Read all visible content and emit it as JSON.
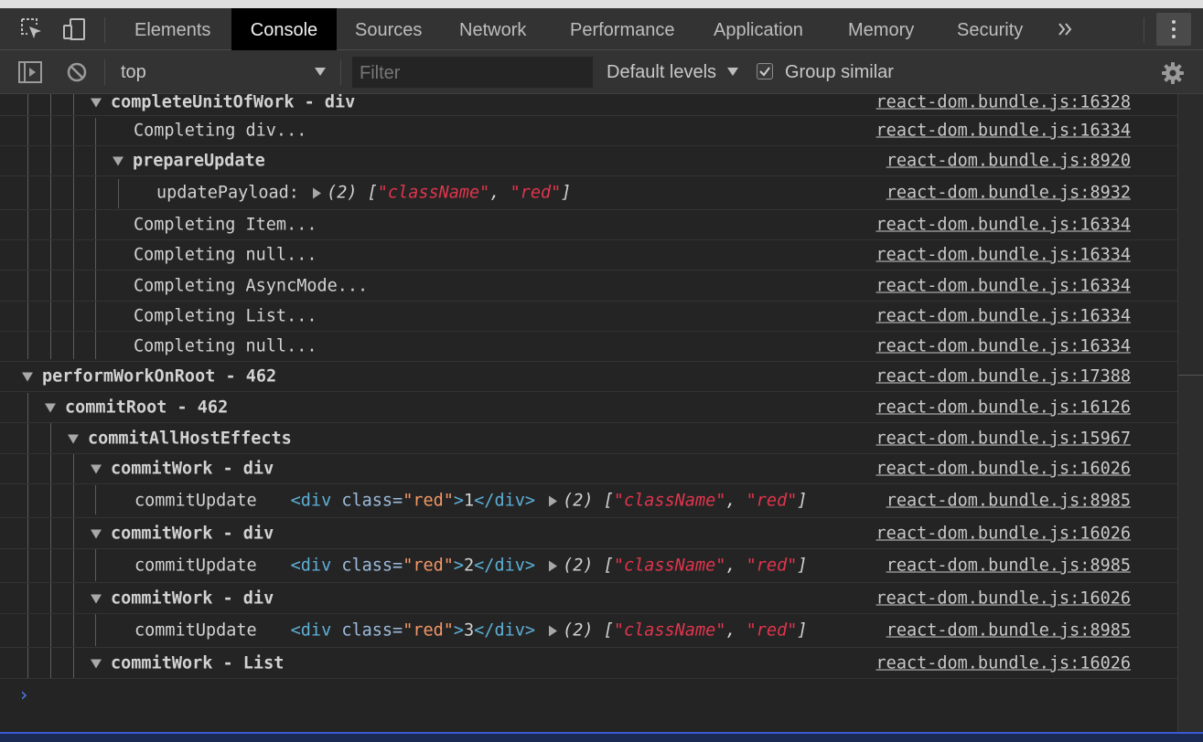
{
  "tabs": [
    "Elements",
    "Console",
    "Sources",
    "Network",
    "Performance",
    "Application",
    "Memory",
    "Security"
  ],
  "toolbar": {
    "context": "top",
    "filter_placeholder": "Filter",
    "levels": "Default levels",
    "group_similar": "Group similar",
    "group_similar_checked": true
  },
  "icons": [
    "inspect-icon",
    "device-toolbar-icon",
    "more-tabs-icon",
    "kebab-menu-icon",
    "sidebar-toggle-icon",
    "clear-console-icon",
    "settings-gear-icon"
  ],
  "colors": {
    "string": "#e0354d",
    "tag": "#5db0d7",
    "attr_value": "#f29766",
    "prompt": "#4d7ff0",
    "active_tab": "#000000"
  },
  "console": {
    "rows": [
      {
        "text": "completeUnitOfWork - div",
        "source": "react-dom.bundle.js:16328"
      },
      {
        "text": "Completing div...",
        "source": "react-dom.bundle.js:16334"
      },
      {
        "text": "prepareUpdate",
        "source": "react-dom.bundle.js:8920"
      },
      {
        "label": "updatePayload:",
        "arr_count": "(2)",
        "arr_open": "[",
        "s1": "\"className\"",
        "comma": ", ",
        "s2": "\"red\"",
        "arr_close": "]",
        "source": "react-dom.bundle.js:8932"
      },
      {
        "text": "Completing Item...",
        "source": "react-dom.bundle.js:16334"
      },
      {
        "text": "Completing null...",
        "source": "react-dom.bundle.js:16334"
      },
      {
        "text": "Completing AsyncMode...",
        "source": "react-dom.bundle.js:16334"
      },
      {
        "text": "Completing List...",
        "source": "react-dom.bundle.js:16334"
      },
      {
        "text": "Completing null...",
        "source": "react-dom.bundle.js:16334"
      },
      {
        "text": "performWorkOnRoot - 462",
        "source": "react-dom.bundle.js:17388"
      },
      {
        "text": "commitRoot - 462",
        "source": "react-dom.bundle.js:16126"
      },
      {
        "text": "commitAllHostEffects",
        "source": "react-dom.bundle.js:15967"
      },
      {
        "text": "commitWork - div",
        "source": "react-dom.bundle.js:16026"
      },
      {
        "label": "commitUpdate",
        "tag_open": "<div",
        "attr": " class=",
        "aval": "\"red\"",
        "gt": ">",
        "content": "1",
        "tag_close": "</div>",
        "arr_count": "(2)",
        "arr_open": "[",
        "s1": "\"className\"",
        "comma": ", ",
        "s2": "\"red\"",
        "arr_close": "]",
        "source": "react-dom.bundle.js:8985"
      },
      {
        "text": "commitWork - div",
        "source": "react-dom.bundle.js:16026"
      },
      {
        "label": "commitUpdate",
        "tag_open": "<div",
        "attr": " class=",
        "aval": "\"red\"",
        "gt": ">",
        "content": "2",
        "tag_close": "</div>",
        "arr_count": "(2)",
        "arr_open": "[",
        "s1": "\"className\"",
        "comma": ", ",
        "s2": "\"red\"",
        "arr_close": "]",
        "source": "react-dom.bundle.js:8985"
      },
      {
        "text": "commitWork - div",
        "source": "react-dom.bundle.js:16026"
      },
      {
        "label": "commitUpdate",
        "tag_open": "<div",
        "attr": " class=",
        "aval": "\"red\"",
        "gt": ">",
        "content": "3",
        "tag_close": "</div>",
        "arr_count": "(2)",
        "arr_open": "[",
        "s1": "\"className\"",
        "comma": ", ",
        "s2": "\"red\"",
        "arr_close": "]",
        "source": "react-dom.bundle.js:8985"
      },
      {
        "text": "commitWork - List",
        "source": "react-dom.bundle.js:16026"
      }
    ],
    "prompt": "›"
  }
}
